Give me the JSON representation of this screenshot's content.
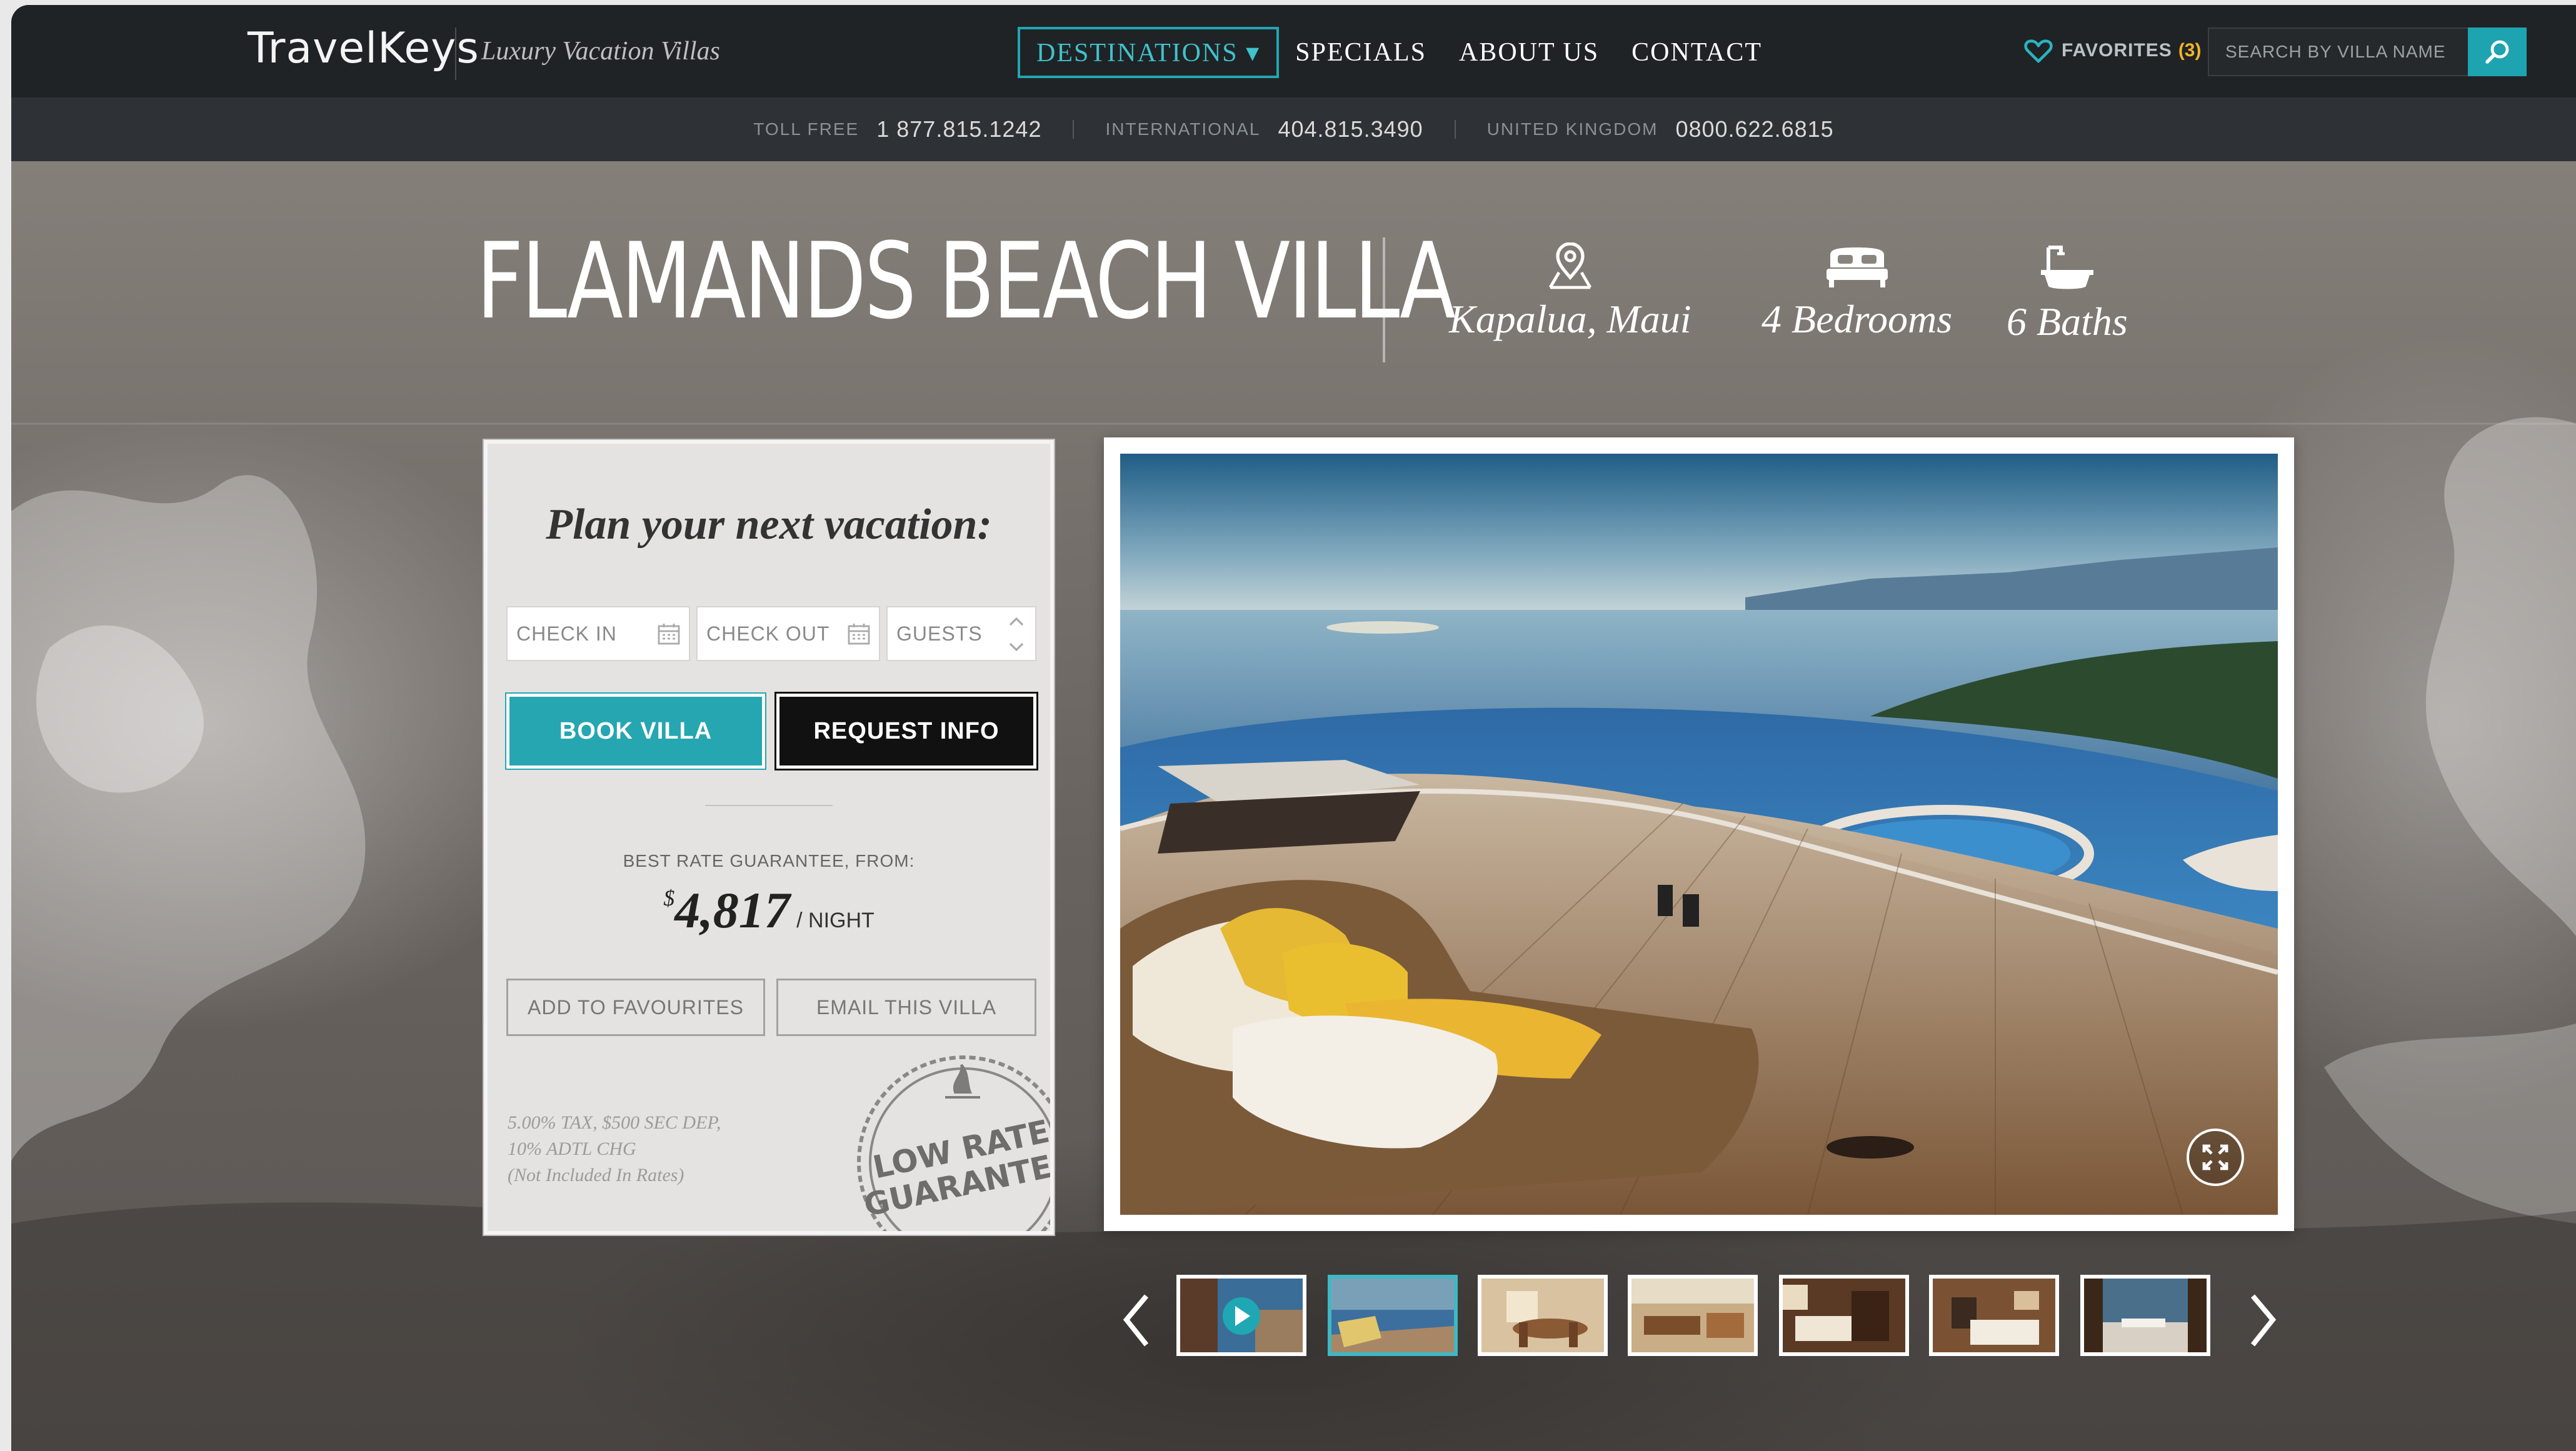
{
  "header": {
    "logo": "TravelKeys",
    "tagline": "Luxury Vacation Villas",
    "nav": [
      {
        "label": "DESTINATIONS ▾",
        "active": true
      },
      {
        "label": "SPECIALS"
      },
      {
        "label": "ABOUT US"
      },
      {
        "label": "CONTACT"
      }
    ],
    "favorites_label": "FAVORITES",
    "favorites_count": "(3)",
    "search_placeholder": "SEARCH BY VILLA NAME"
  },
  "phones": [
    {
      "label": "TOLL FREE",
      "number": "1 877.815.1242"
    },
    {
      "label": "INTERNATIONAL",
      "number": "404.815.3490"
    },
    {
      "label": "UNITED KINGDOM",
      "number": "0800.622.6815"
    }
  ],
  "villa": {
    "name": "FLAMANDS BEACH VILLA",
    "location": "Kapalua, Maui",
    "bedrooms": "4 Bedrooms",
    "baths": "6 Baths"
  },
  "booking": {
    "title": "Plan your next vacation:",
    "check_in": "CHECK IN",
    "check_out": "CHECK OUT",
    "guests": "GUESTS",
    "book_label": "BOOK VILLA",
    "info_label": "REQUEST INFO",
    "rate_label": "BEST RATE GUARANTEE, FROM:",
    "currency": "$",
    "price": "4,817",
    "per": "/ NIGHT",
    "fav_label": "ADD TO FAVOURITES",
    "email_label": "EMAIL THIS VILLA",
    "tax_lines": [
      "5.00% TAX, $500 SEC DEP,",
      "10% ADTL CHG",
      "(Not Included In Rates)"
    ],
    "stamp_text": [
      "LOW RATE",
      "GUARANTEE"
    ]
  },
  "colors": {
    "accent": "#25a6b1",
    "nav_bg": "#1f2326",
    "subbar_bg": "#2e3236",
    "favorites_count": "#f1b42a"
  },
  "gallery": {
    "active_index": 1,
    "thumbs": [
      "video-thumb",
      "pool-deck-thumb",
      "dining-room-thumb",
      "living-room-thumb",
      "bedroom-thumb",
      "bedroom-two-thumb",
      "terrace-view-thumb"
    ]
  }
}
